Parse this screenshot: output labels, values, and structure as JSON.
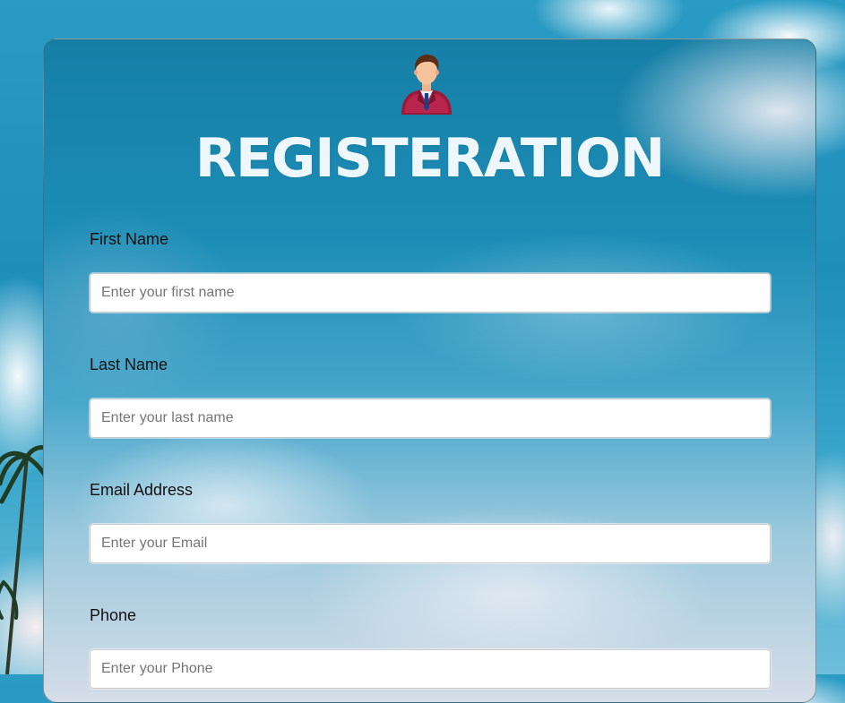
{
  "form": {
    "title": "REGISTERATION",
    "fields": [
      {
        "label": "First Name",
        "placeholder": "Enter your first name"
      },
      {
        "label": "Last Name",
        "placeholder": "Enter your last name"
      },
      {
        "label": "Email Address",
        "placeholder": "Enter your Email"
      },
      {
        "label": "Phone",
        "placeholder": "Enter your Phone"
      }
    ]
  },
  "colors": {
    "title": "#eef8fc",
    "sky": "#1e8fbb",
    "input_border": "#c9c9c9"
  },
  "icons": {
    "avatar": "user-businessman-icon"
  }
}
